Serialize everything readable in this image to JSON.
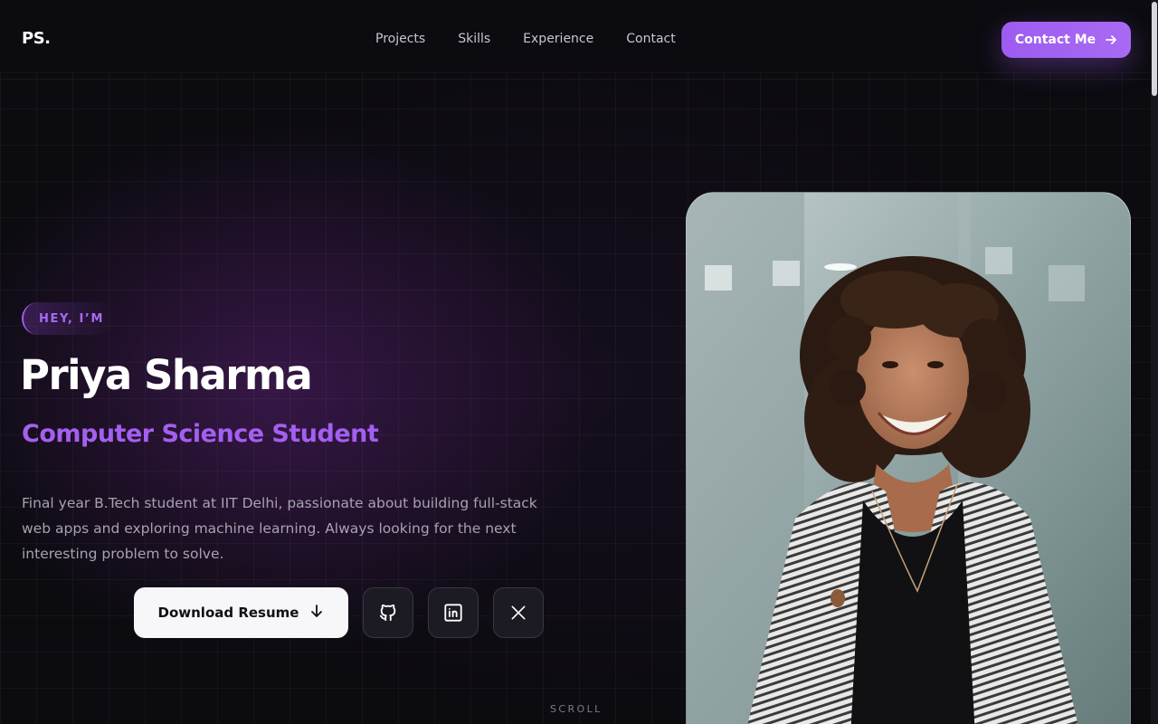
{
  "header": {
    "logo": "PS.",
    "nav": [
      {
        "label": "Projects"
      },
      {
        "label": "Skills"
      },
      {
        "label": "Experience"
      },
      {
        "label": "Contact"
      }
    ],
    "cta_label": "Contact Me",
    "cta_icon": "arrow-right-icon"
  },
  "hero": {
    "badge": "HEY, I’M",
    "name": "Priya Sharma",
    "role": "Computer Science Student",
    "bio": "Final year B.Tech student at IIT Delhi, passionate about building full-stack web apps and exploring machine learning. Always looking for the next interesting problem to solve.",
    "resume_label": "Download Resume",
    "resume_icon": "arrow-down-icon",
    "socials": [
      {
        "icon": "github-icon"
      },
      {
        "icon": "linkedin-icon"
      },
      {
        "icon": "x-icon"
      }
    ],
    "scroll_label": "SCROLL",
    "photo": "portrait-photo"
  },
  "colors": {
    "background": "#0c0b10",
    "accent": "#a45ff0",
    "text": "#ffffff",
    "muted": "#a7a2b0"
  }
}
